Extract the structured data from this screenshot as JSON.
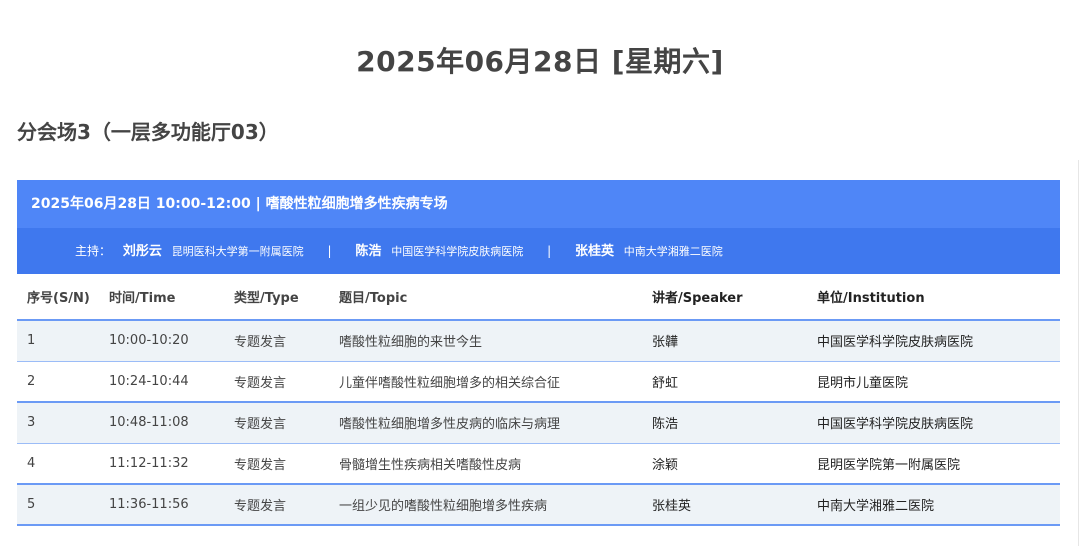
{
  "page": {
    "date_title": "2025年06月28日 [星期六]",
    "venue_title": "分会场3（一层多功能厅03）"
  },
  "session": {
    "title": "2025年06月28日 10:00-12:00 | 嗜酸性粒细胞增多性疾病专场",
    "host_label": "主持：",
    "hosts": [
      {
        "name": "刘彤云",
        "org": "昆明医科大学第一附属医院"
      },
      {
        "name": "陈浩",
        "org": "中国医学科学院皮肤病医院"
      },
      {
        "name": "张桂英",
        "org": "中南大学湘雅二医院"
      }
    ],
    "separator": "|"
  },
  "table": {
    "headers": [
      "序号(S/N)",
      "时间/Time",
      "类型/Type",
      "题目/Topic",
      "讲者/Speaker",
      "单位/Institution"
    ],
    "rows": [
      [
        "1",
        "10:00-10:20",
        "专题发言",
        "嗜酸性粒细胞的来世今生",
        "张韡",
        "中国医学科学院皮肤病医院"
      ],
      [
        "2",
        "10:24-10:44",
        "专题发言",
        "儿童伴嗜酸性粒细胞增多的相关综合征",
        "舒虹",
        "昆明市儿童医院"
      ],
      [
        "3",
        "10:48-11:08",
        "专题发言",
        "嗜酸性粒细胞增多性皮病的临床与病理",
        "陈浩",
        "中国医学科学院皮肤病医院"
      ],
      [
        "4",
        "11:12-11:32",
        "专题发言",
        "骨髓增生性疾病相关嗜酸性皮病",
        "涂颖",
        "昆明医学院第一附属医院"
      ],
      [
        "5",
        "11:36-11:56",
        "专题发言",
        "一组少见的嗜酸性粒细胞增多性疾病",
        "张桂英",
        "中南大学湘雅二医院"
      ]
    ]
  }
}
